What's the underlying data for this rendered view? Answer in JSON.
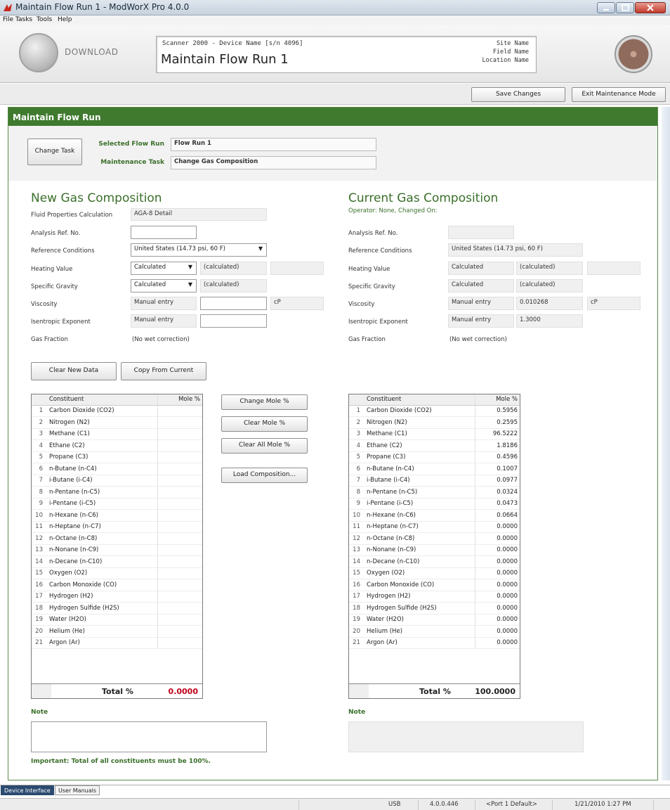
{
  "window": {
    "title": "Maintain Flow Run 1 - ModWorX Pro 4.0.0"
  },
  "menu": [
    "File",
    "Tasks",
    "Tools",
    "Help"
  ],
  "header": {
    "download_label": "DOWNLOAD",
    "device_line": "Scanner 2000 - Device Name [s/n 4096]",
    "device_title": "Maintain Flow Run 1",
    "site": "Site Name",
    "field": "Field Name",
    "location": "Location Name"
  },
  "toolbar": {
    "save": "Save Changes",
    "exit": "Exit Maintenance Mode"
  },
  "panel": {
    "title": "Maintain Flow Run",
    "change_task": "Change Task",
    "selected_label": "Selected Flow Run",
    "selected_value": "Flow Run 1",
    "task_label": "Maintenance Task",
    "task_value": "Change Gas Composition"
  },
  "new": {
    "heading": "New Gas Composition",
    "fluid_label": "Fluid Properties Calculation",
    "fluid_value": "AGA-8 Detail",
    "analysis_label": "Analysis Ref. No.",
    "analysis_value": "",
    "ref_label": "Reference Conditions",
    "ref_value": "United States (14.73 psi, 60 F)",
    "heating_label": "Heating Value",
    "heating_value": "Calculated",
    "heating_calc": "(calculated)",
    "sg_label": "Specific Gravity",
    "sg_value": "Calculated",
    "sg_calc": "(calculated)",
    "visc_label": "Viscosity",
    "visc_value": "Manual entry",
    "visc_unit": "cP",
    "isen_label": "Isentropic Exponent",
    "isen_value": "Manual entry",
    "gas_label": "Gas Fraction",
    "gas_value": "(No wet correction)",
    "clear_btn": "Clear New Data",
    "copy_btn": "Copy From Current",
    "total_label": "Total %",
    "total_value": "0.0000",
    "note_label": "Note",
    "important": "Important: Total of all constituents must be 100%."
  },
  "mid_buttons": {
    "change": "Change Mole %",
    "clear": "Clear Mole %",
    "clear_all": "Clear All Mole %",
    "load": "Load Composition..."
  },
  "current": {
    "heading": "Current Gas Composition",
    "operator": "Operator: None, Changed On:",
    "analysis_label": "Analysis Ref. No.",
    "ref_label": "Reference Conditions",
    "ref_value": "United States (14.73 psi, 60 F)",
    "heating_label": "Heating Value",
    "heating_value": "Calculated",
    "heating_calc": "(calculated)",
    "sg_label": "Specific Gravity",
    "sg_value": "Calculated",
    "sg_calc": "(calculated)",
    "visc_label": "Viscosity",
    "visc_value": "Manual entry",
    "visc_num": "0.010268",
    "visc_unit": "cP",
    "isen_label": "Isentropic Exponent",
    "isen_value": "Manual entry",
    "isen_num": "1.3000",
    "gas_label": "Gas Fraction",
    "gas_value": "(No wet correction)",
    "total_label": "Total %",
    "total_value": "100.0000",
    "note_label": "Note"
  },
  "table": {
    "col_constituent": "Constituent",
    "col_mole": "Mole %",
    "rows": [
      {
        "n": "1",
        "name": "Carbon Dioxide (CO2)",
        "current": "0.5956"
      },
      {
        "n": "2",
        "name": "Nitrogen (N2)",
        "current": "0.2595"
      },
      {
        "n": "3",
        "name": "Methane (C1)",
        "current": "96.5222"
      },
      {
        "n": "4",
        "name": "Ethane (C2)",
        "current": "1.8186"
      },
      {
        "n": "5",
        "name": "Propane (C3)",
        "current": "0.4596"
      },
      {
        "n": "6",
        "name": "n-Butane (n-C4)",
        "current": "0.1007"
      },
      {
        "n": "7",
        "name": "i-Butane (i-C4)",
        "current": "0.0977"
      },
      {
        "n": "8",
        "name": "n-Pentane (n-C5)",
        "current": "0.0324"
      },
      {
        "n": "9",
        "name": "i-Pentane (i-C5)",
        "current": "0.0473"
      },
      {
        "n": "10",
        "name": "n-Hexane (n-C6)",
        "current": "0.0664"
      },
      {
        "n": "11",
        "name": "n-Heptane (n-C7)",
        "current": "0.0000"
      },
      {
        "n": "12",
        "name": "n-Octane (n-C8)",
        "current": "0.0000"
      },
      {
        "n": "13",
        "name": "n-Nonane (n-C9)",
        "current": "0.0000"
      },
      {
        "n": "14",
        "name": "n-Decane (n-C10)",
        "current": "0.0000"
      },
      {
        "n": "15",
        "name": "Oxygen (O2)",
        "current": "0.0000"
      },
      {
        "n": "16",
        "name": "Carbon Monoxide (CO)",
        "current": "0.0000"
      },
      {
        "n": "17",
        "name": "Hydrogen (H2)",
        "current": "0.0000"
      },
      {
        "n": "18",
        "name": "Hydrogen Sulfide (H2S)",
        "current": "0.0000"
      },
      {
        "n": "19",
        "name": "Water (H2O)",
        "current": "0.0000"
      },
      {
        "n": "20",
        "name": "Helium (He)",
        "current": "0.0000"
      },
      {
        "n": "21",
        "name": "Argon (Ar)",
        "current": "0.0000"
      }
    ]
  },
  "tabs": [
    "Device Interface",
    "User Manuals"
  ],
  "status": {
    "conn": "USB",
    "version": "4.0.0.446",
    "port": "<Port 1 Default>",
    "datetime": "1/21/2010 1:27 PM"
  },
  "colors": {
    "panel_green": "#3f7a2e",
    "heading_green": "#3a6f2a",
    "total_red": "#c0001a"
  }
}
